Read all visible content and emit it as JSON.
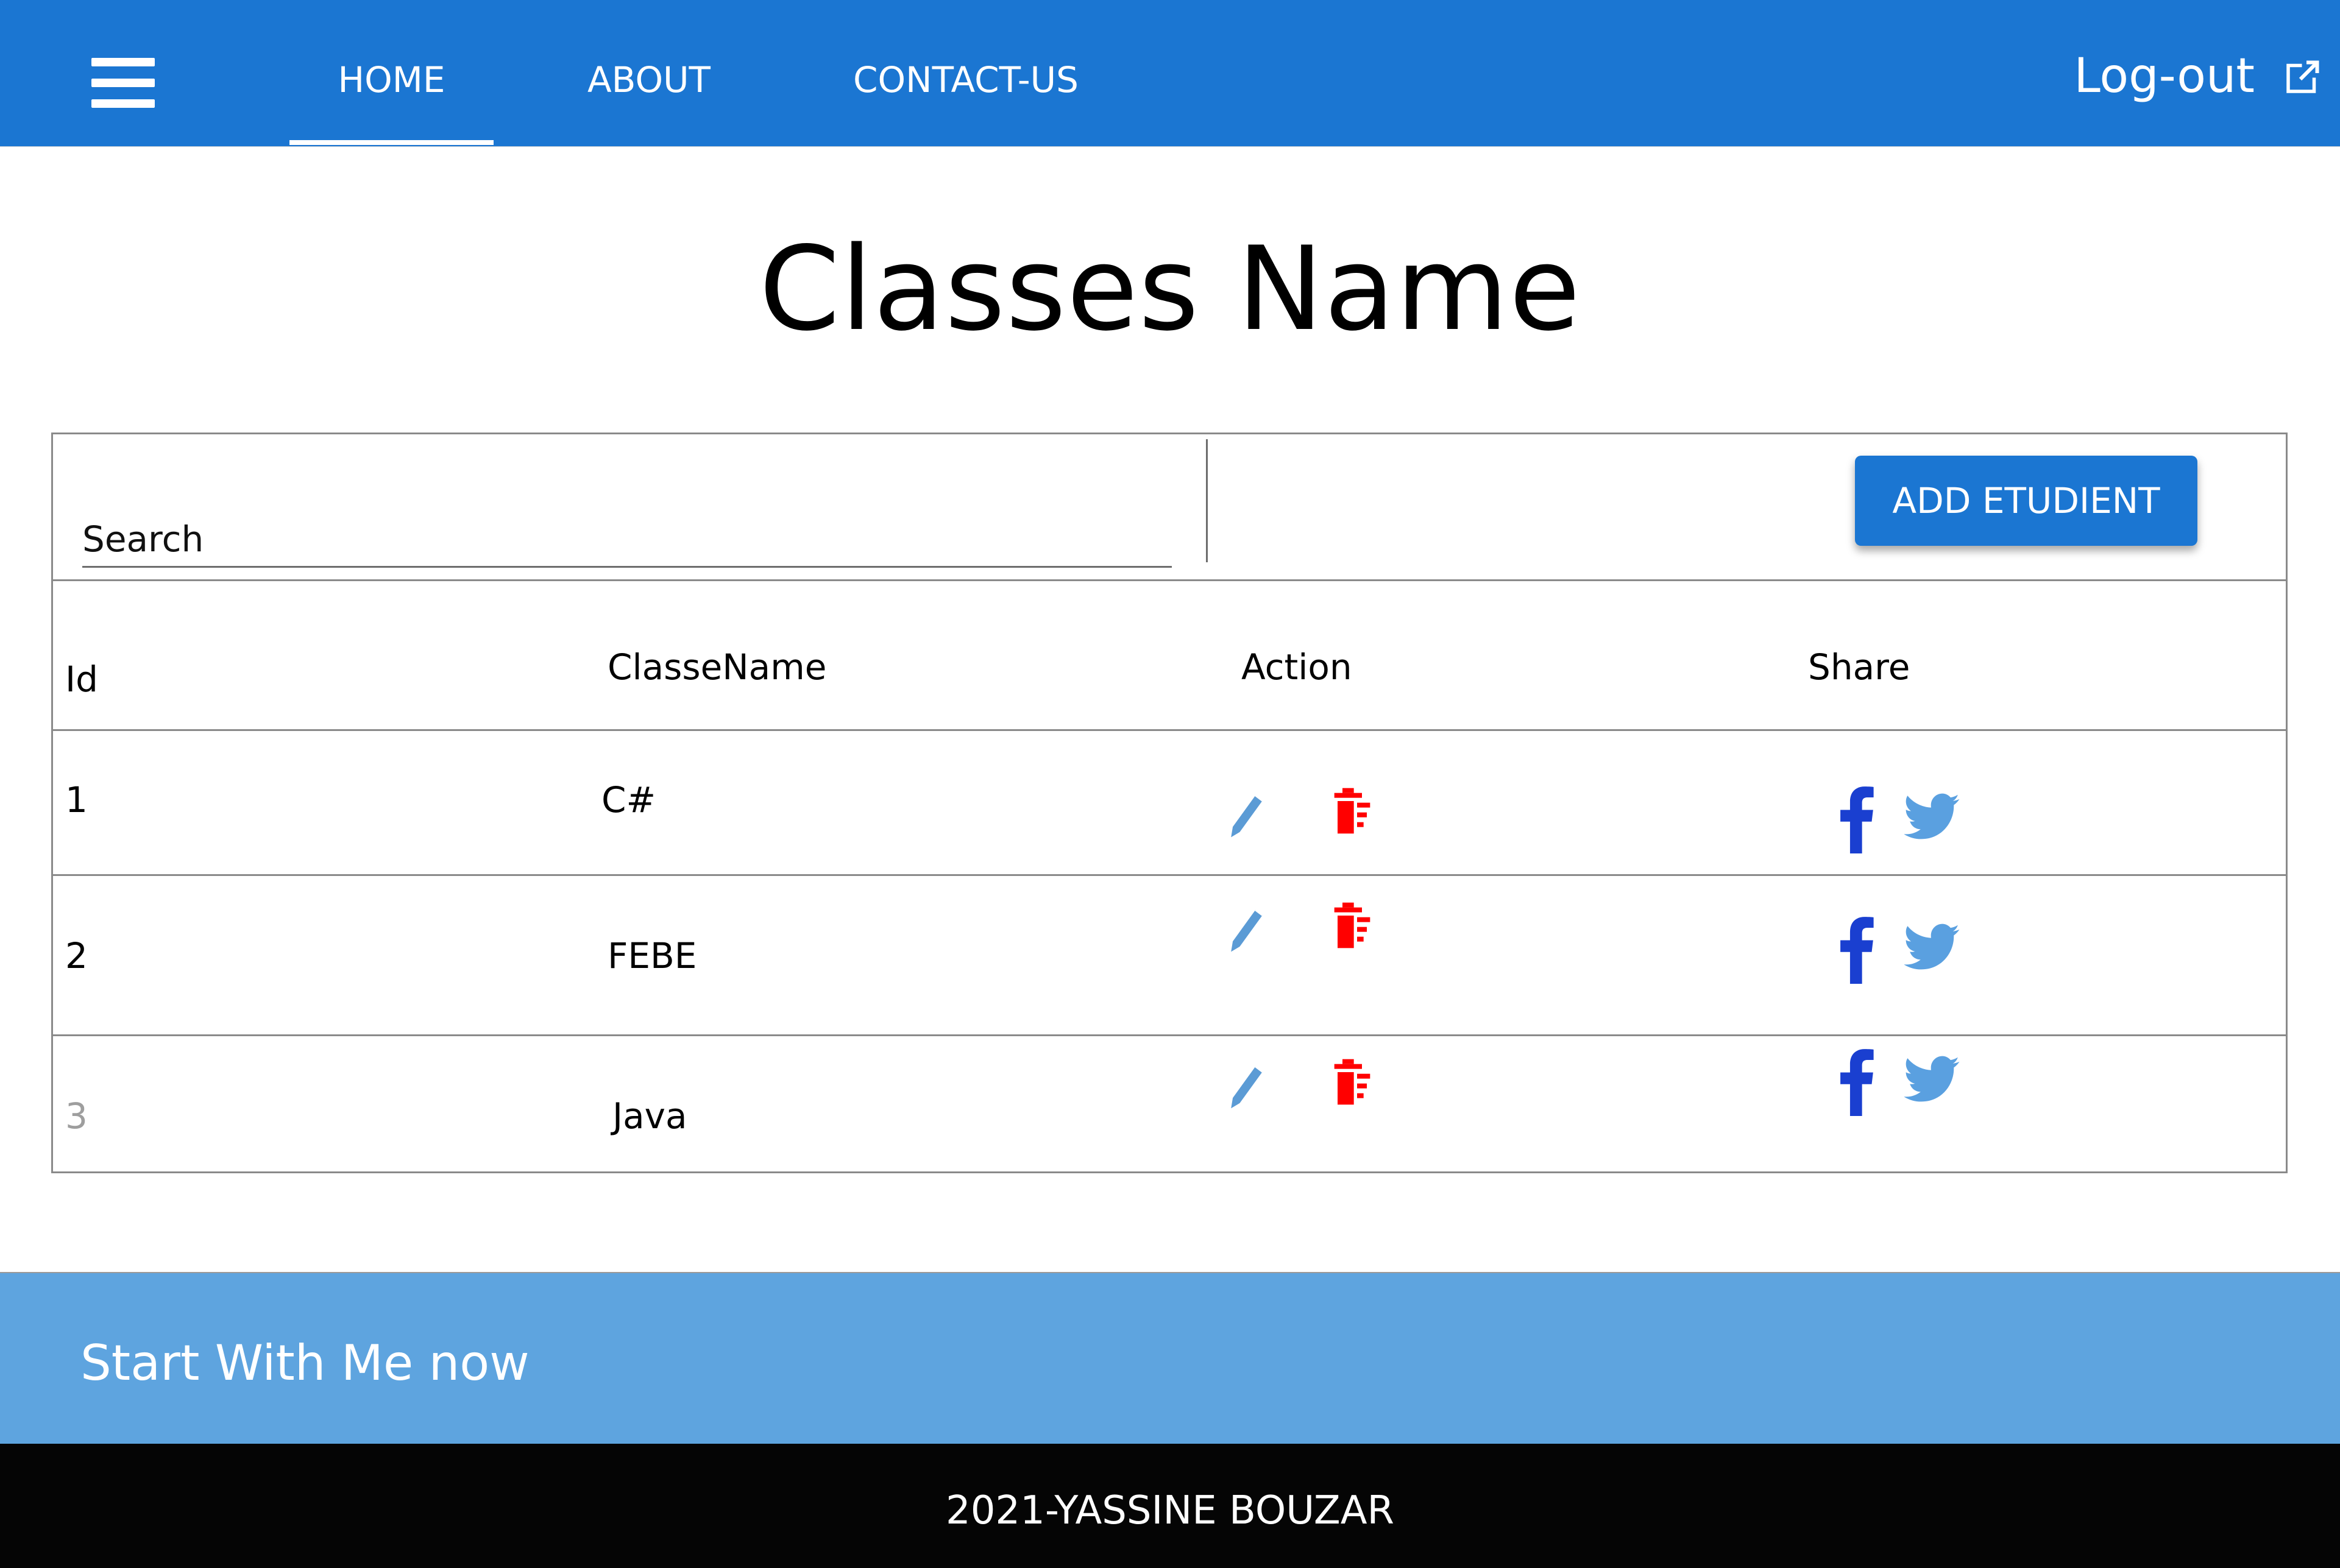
{
  "nav": {
    "items": [
      {
        "label": "HOME",
        "active": true
      },
      {
        "label": "ABOUT",
        "active": false
      },
      {
        "label": "CONTACT-US",
        "active": false
      }
    ],
    "logout_label": "Log-out",
    "menu_icon": "hamburger-menu-icon",
    "logout_icon": "external-link-icon"
  },
  "page": {
    "title": "Classes Name"
  },
  "toolbar": {
    "search_placeholder": "Search",
    "search_value": "",
    "add_button_label": "ADD ETUDIENT"
  },
  "table": {
    "columns": [
      "Id",
      "ClasseName",
      "Action",
      "Share"
    ],
    "rows": [
      {
        "id": "1",
        "name": "C#"
      },
      {
        "id": "2",
        "name": "FEBE"
      },
      {
        "id": "3",
        "name": "Java"
      }
    ],
    "action_icons": [
      "pencil-edit-icon",
      "trash-delete-icon"
    ],
    "share_icons": [
      "facebook-icon",
      "twitter-icon"
    ]
  },
  "footer": {
    "cta_text": "Start With Me now",
    "copyright": "2021-YASSINE BOUZAR"
  },
  "colors": {
    "primary": "#1b76d2",
    "cta_background": "#5ea4df",
    "edit_icon": "#5b9bd5",
    "delete_icon": "#ff0000",
    "facebook": "#1a3fd0",
    "twitter": "#5aa0e0",
    "footer_background": "#050505",
    "faded_text": "#9e9e9e"
  }
}
